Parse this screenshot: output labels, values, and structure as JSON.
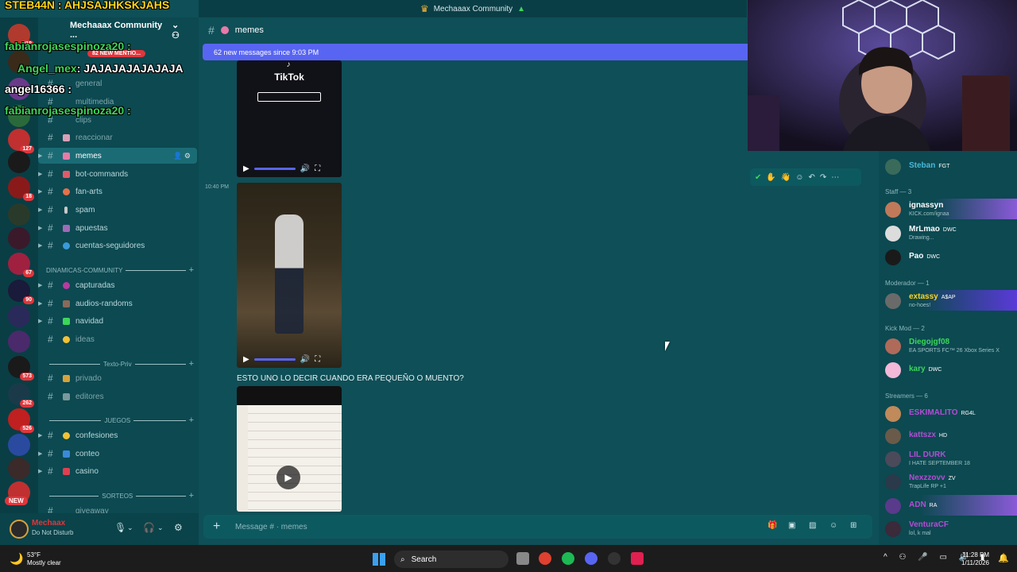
{
  "window": {
    "title": "Mechaaax Community"
  },
  "overlay_chat": {
    "streamer_line": "STEB44N : AHJSAJHKSKJAHS",
    "lines": [
      {
        "name": "fabianrojasespinoza20 :",
        "text": ""
      },
      {
        "name": "Angel_mex",
        "text": ": JAJAJAJAJAJAJA"
      },
      {
        "name": "angel16366 :",
        "text": ""
      },
      {
        "name": "fabianrojasespinoza20 :",
        "text": ""
      }
    ]
  },
  "server": {
    "name": "Mechaaax Community ...",
    "mention_pill": "82 NEW MENTIO..."
  },
  "rail": {
    "badges": [
      "319",
      "127",
      "18",
      "67",
      "90",
      "573",
      "262",
      "526"
    ],
    "new_label": "NEW"
  },
  "channels": [
    {
      "label": "general",
      "name": "general"
    },
    {
      "label": "multimedia",
      "name": "multimedia"
    },
    {
      "label": "clips",
      "name": "clips"
    },
    {
      "label": "reaccionar",
      "name": "reaccionar"
    },
    {
      "label": "memes",
      "name": "memes"
    },
    {
      "label": "bot-commands",
      "name": "bot-commands"
    },
    {
      "label": "fan-arts",
      "name": "fan-arts"
    },
    {
      "label": "spam",
      "name": "spam"
    },
    {
      "label": "apuestas",
      "name": "apuestas"
    },
    {
      "label": "cuentas-seguidores",
      "name": "cuentas-seguidores"
    },
    {
      "label": "capturadas",
      "name": "capturadas"
    },
    {
      "label": "audios-randoms",
      "name": "audios-randoms"
    },
    {
      "label": "navidad",
      "name": "navidad"
    },
    {
      "label": "ideas",
      "name": "ideas"
    },
    {
      "label": "privado",
      "name": "privado"
    },
    {
      "label": "editores",
      "name": "editores"
    },
    {
      "label": "confesiones",
      "name": "confesiones"
    },
    {
      "label": "conteo",
      "name": "conteo"
    },
    {
      "label": "casino",
      "name": "casino"
    },
    {
      "label": "giveaway",
      "name": "giveaway"
    }
  ],
  "categories": {
    "dinamicas": "DINAMICAS-COMMUNITY",
    "texto_priv": "Texto-Priv",
    "juegos": "JUEGOS",
    "sorteos": "SORTEOS"
  },
  "user": {
    "name": "Mechaax",
    "status": "Do Not Disturb"
  },
  "chat": {
    "channel": "memes",
    "banner": "62 new messages since 9:03 PM",
    "tiktok_label": "TikTok",
    "timestamp": "10:40 PM",
    "message": "ESTO UNO LO DECIR CUANDO ERA PEQUEÑO O MUENTO?",
    "composer_placeholder": "Message # · memes"
  },
  "members": {
    "top": {
      "name": "Steban",
      "tag": "FGT"
    },
    "sections": [
      {
        "title": "Staff — 3",
        "members": [
          {
            "name": "ignassyn",
            "tag": "",
            "sub": "KICK.com/ignaa",
            "color": "#ffffff"
          },
          {
            "name": "MrLmao",
            "tag": "DWC",
            "sub": "Drawing...",
            "color": "#ffffff"
          },
          {
            "name": "Pao",
            "tag": "DWC",
            "sub": "",
            "color": "#ffffff"
          }
        ]
      },
      {
        "title": "Moderador — 1",
        "members": [
          {
            "name": "extassy",
            "tag": "A$AP",
            "sub": "no-hoes!",
            "color": "#ffd51a"
          }
        ]
      },
      {
        "title": "Kick Mod — 2",
        "members": [
          {
            "name": "Diegojgf08",
            "tag": "",
            "sub": "EA SPORTS FC™ 26 Xbox Series X",
            "color": "#3cd65a"
          },
          {
            "name": "kary",
            "tag": "DWC",
            "sub": "",
            "color": "#3cd65a"
          }
        ]
      },
      {
        "title": "Streamers — 6",
        "members": [
          {
            "name": "ESKIMALITO",
            "tag": "RG4L",
            "sub": "",
            "color": "#b64bd6"
          },
          {
            "name": "kattszx",
            "tag": "HD",
            "sub": "",
            "color": "#b64bd6"
          },
          {
            "name": "LIL DURK",
            "tag": "",
            "sub": "I HATE SEPTEMBER 18",
            "color": "#b64bd6"
          },
          {
            "name": "Nexzzovv",
            "tag": "ZV",
            "sub": "TrapLife RP +1",
            "color": "#b64bd6"
          },
          {
            "name": "ADN",
            "tag": "RA",
            "sub": "",
            "color": "#b64bd6"
          },
          {
            "name": "VenturaCF",
            "tag": "",
            "sub": "lol, k mal",
            "color": "#b64bd6"
          }
        ]
      }
    ]
  },
  "taskbar": {
    "temp": "53°F",
    "weather": "Mostly clear",
    "search": "Search",
    "time": "11:28 PM",
    "date": "1/11/2026"
  },
  "colors": {
    "accent": "#5865f2",
    "bg": "#0f4f57",
    "dnd": "#e0363c"
  }
}
